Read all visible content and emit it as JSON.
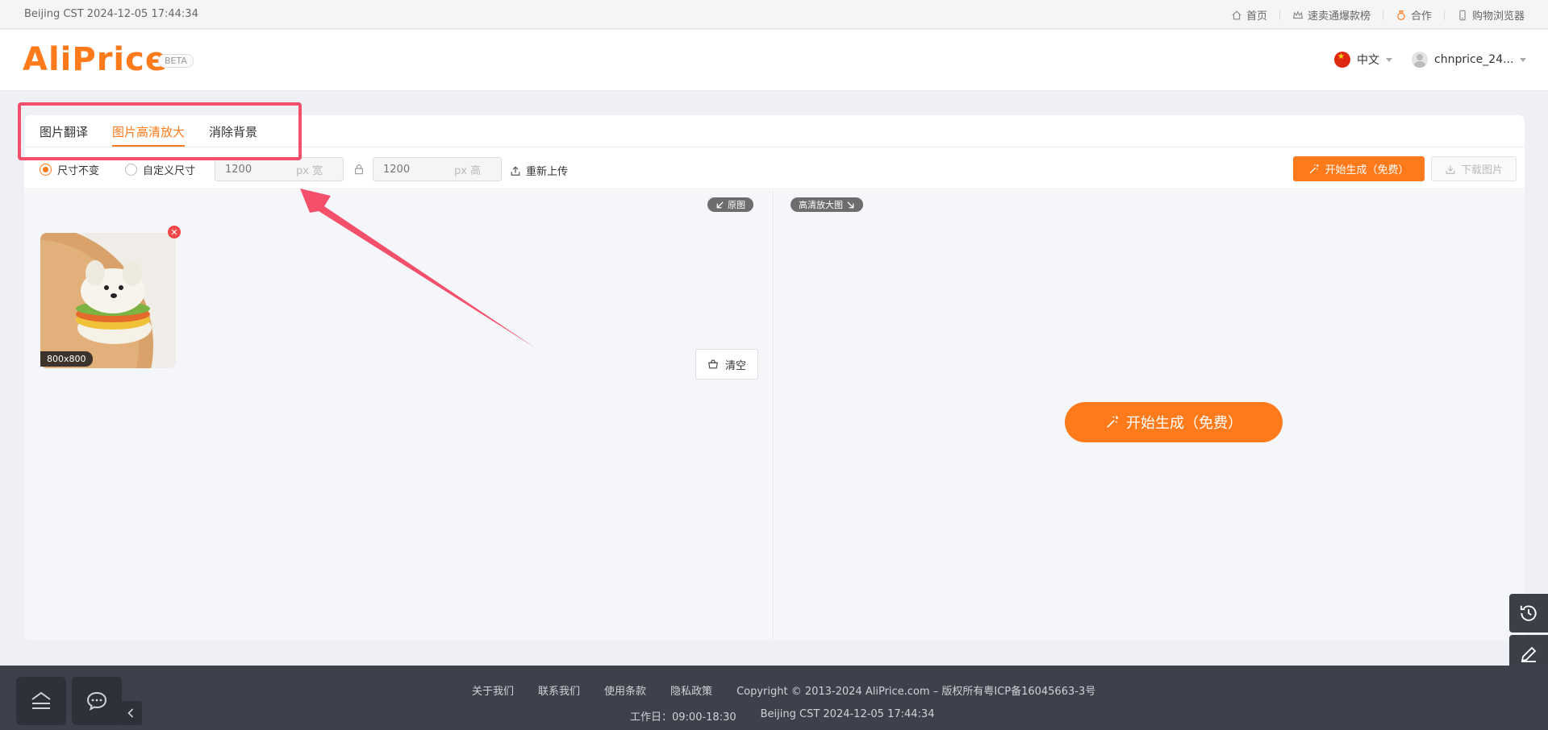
{
  "topbar": {
    "time": "Beijing CST  2024-12-05 17:44:34",
    "links": [
      {
        "label": "首页",
        "icon": "home-icon"
      },
      {
        "label": "速卖通爆款榜",
        "icon": "crown-icon"
      },
      {
        "label": "合作",
        "icon": "money-bag-icon"
      },
      {
        "label": "购物浏览器",
        "icon": "phone-icon"
      }
    ]
  },
  "header": {
    "logo": "AliPrice",
    "beta": "BETA",
    "language": "中文",
    "username": "chnprice_24..."
  },
  "tabs": [
    {
      "label": "图片翻译",
      "active": false
    },
    {
      "label": "图片高清放大",
      "active": true
    },
    {
      "label": "消除背景",
      "active": false
    }
  ],
  "toolbar": {
    "option_keep": "尺寸不变",
    "option_custom": "自定义尺寸",
    "width_placeholder": "1200",
    "width_unit": "px 宽",
    "height_placeholder": "1200",
    "height_unit": "px 高",
    "reupload": "重新上传",
    "generate": "开始生成（免费）",
    "download": "下载图片"
  },
  "left_pane": {
    "tag": "原图",
    "image_size": "800x800",
    "clear": "清空"
  },
  "right_pane": {
    "tag": "高清放大图",
    "generate": "开始生成（免费）"
  },
  "footer": {
    "links": [
      "关于我们",
      "联系我们",
      "使用条款",
      "隐私政策"
    ],
    "copyright": "Copyright © 2013-2024 AliPrice.com – 版权所有粤ICP备16045663-3号",
    "hours": "工作日：09:00-18:30",
    "time": "Beijing CST  2024-12-05 17:44:34"
  },
  "colors": {
    "accent": "#ff7a1a",
    "annotation": "#f4506c",
    "footer_bg": "#3d414b"
  }
}
